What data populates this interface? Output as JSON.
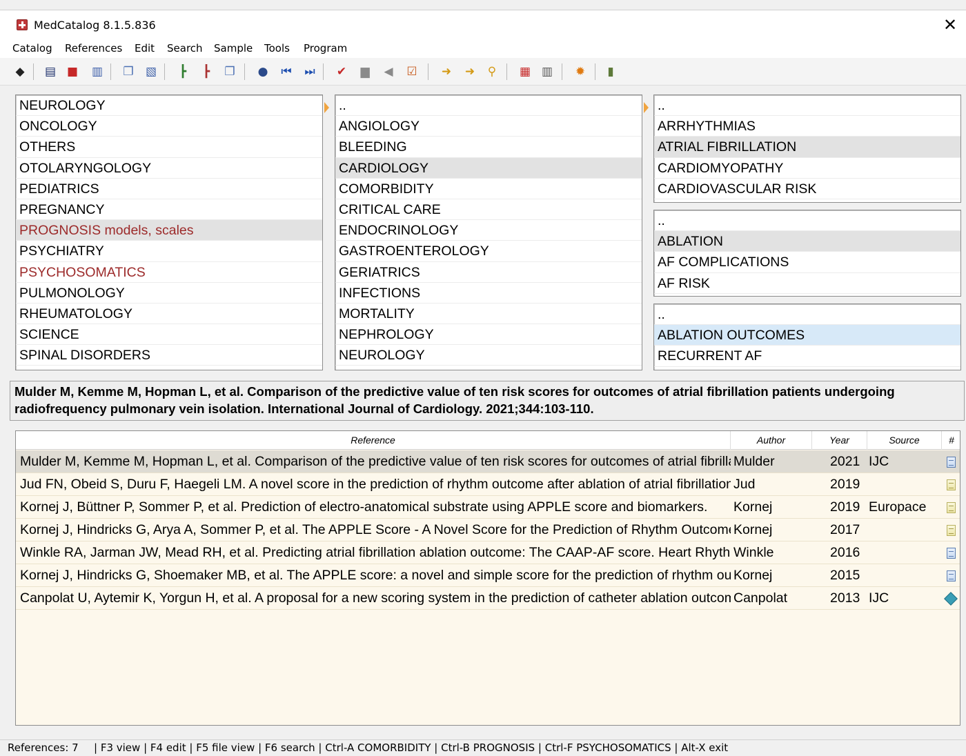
{
  "window": {
    "title": "MedCatalog 8.1.5.836",
    "close": "✕"
  },
  "menu": [
    "Catalog",
    "References",
    "Edit",
    "Search",
    "Sample",
    "Tools",
    "Program"
  ],
  "toolbar": {
    "icons": [
      "eraser-icon",
      "clipboard-icon",
      "red-book-icon",
      "open-book-icon",
      "copy-icon",
      "word-icon",
      "add-branch-icon",
      "delete-branch-icon",
      "copy-branch-icon",
      "binoculars-icon",
      "first-icon",
      "last-icon",
      "check-icon",
      "gray-doc-icon",
      "gray-back-icon",
      "checklist-icon",
      "import-icon",
      "export-icon",
      "find-doc-icon",
      "add-db-icon",
      "trash-icon",
      "settings-gear-icon",
      "exit-door-icon"
    ]
  },
  "panels": {
    "left": [
      "NEUROLOGY",
      "ONCOLOGY",
      "OTHERS",
      "OTOLARYNGOLOGY",
      "PEDIATRICS",
      "PREGNANCY",
      "PROGNOSIS models, scales",
      "PSYCHIATRY",
      "PSYCHOSOMATICS",
      "PULMONOLOGY",
      "RHEUMATOLOGY",
      "SCIENCE",
      "SPINAL DISORDERS"
    ],
    "middle": [
      "..",
      "ANGIOLOGY",
      "BLEEDING",
      "CARDIOLOGY",
      "COMORBIDITY",
      "CRITICAL CARE",
      "ENDOCRINOLOGY",
      "GASTROENTEROLOGY",
      "GERIATRICS",
      "INFECTIONS",
      "MORTALITY",
      "NEPHROLOGY",
      "NEUROLOGY"
    ],
    "right1": [
      "..",
      "ARRHYTHMIAS",
      "ATRIAL FIBRILLATION",
      "CARDIOMYOPATHY",
      "CARDIOVASCULAR RISK"
    ],
    "right2": [
      "..",
      "ABLATION",
      "AF COMPLICATIONS",
      "AF RISK"
    ],
    "right3": [
      "..",
      "ABLATION OUTCOMES",
      "RECURRENT AF"
    ]
  },
  "selected_reference": "Mulder M, Kemme M, Hopman L, et al. Comparison of the predictive value of ten risk scores for outcomes of atrial fibrillation patients undergoing radiofrequency pulmonary vein isolation. International Journal of Cardiology. 2021;344:103-110.",
  "grid": {
    "headers": {
      "reference": "Reference",
      "author": "Author",
      "year": "Year",
      "source": "Source",
      "num": "#"
    },
    "rows": [
      {
        "ref": "Mulder M, Kemme M, Hopman L, et al. Comparison of the predictive value of ten risk scores for outcomes of atrial fibrillation patients undergoing radiofrequency pulmonary vein isolation.",
        "author": "Mulder",
        "year": "2021",
        "source": "IJC",
        "icon": "blue-doc-icon"
      },
      {
        "ref": "Jud FN, Obeid S, Duru F, Haegeli LM. A novel score in the prediction of rhythm outcome after ablation of atrial fibrillation.",
        "author": "Jud",
        "year": "2019",
        "source": "",
        "icon": "yellow-doc-icon"
      },
      {
        "ref": "Kornej J, Büttner P, Sommer P, et al. Prediction of electro-anatomical substrate using APPLE score and biomarkers.",
        "author": "Kornej",
        "year": "2019",
        "source": "Europace",
        "icon": "yellow-doc-icon"
      },
      {
        "ref": "Kornej J, Hindricks G, Arya A, Sommer P, et al. The APPLE Score - A Novel Score for the Prediction of Rhythm Outcomes.",
        "author": "Kornej",
        "year": "2017",
        "source": "",
        "icon": "yellow-doc-icon"
      },
      {
        "ref": "Winkle RA, Jarman JW, Mead RH, et al. Predicting atrial fibrillation ablation outcome: The CAAP-AF score. Heart Rhythm.",
        "author": "Winkle",
        "year": "2016",
        "source": "",
        "icon": "blue-doc-icon"
      },
      {
        "ref": "Kornej J, Hindricks G, Shoemaker MB, et al. The APPLE score: a novel and simple score for the prediction of rhythm outcomes.",
        "author": "Kornej",
        "year": "2015",
        "source": "",
        "icon": "blue-doc-icon"
      },
      {
        "ref": "Canpolat U, Aytemir K, Yorgun H, et al. A proposal for a new scoring system in the prediction of catheter ablation outcomes.",
        "author": "Canpolat",
        "year": "2013",
        "source": "IJC",
        "icon": "diamond-icon"
      }
    ]
  },
  "status": {
    "count": "References: 7",
    "shortcuts": "| F3 view | F4 edit | F5 file view | F6 search | Ctrl-A COMORBIDITY | Ctrl-B PROGNOSIS | Ctrl-F PSYCHOSOMATICS | Alt-X exit"
  }
}
